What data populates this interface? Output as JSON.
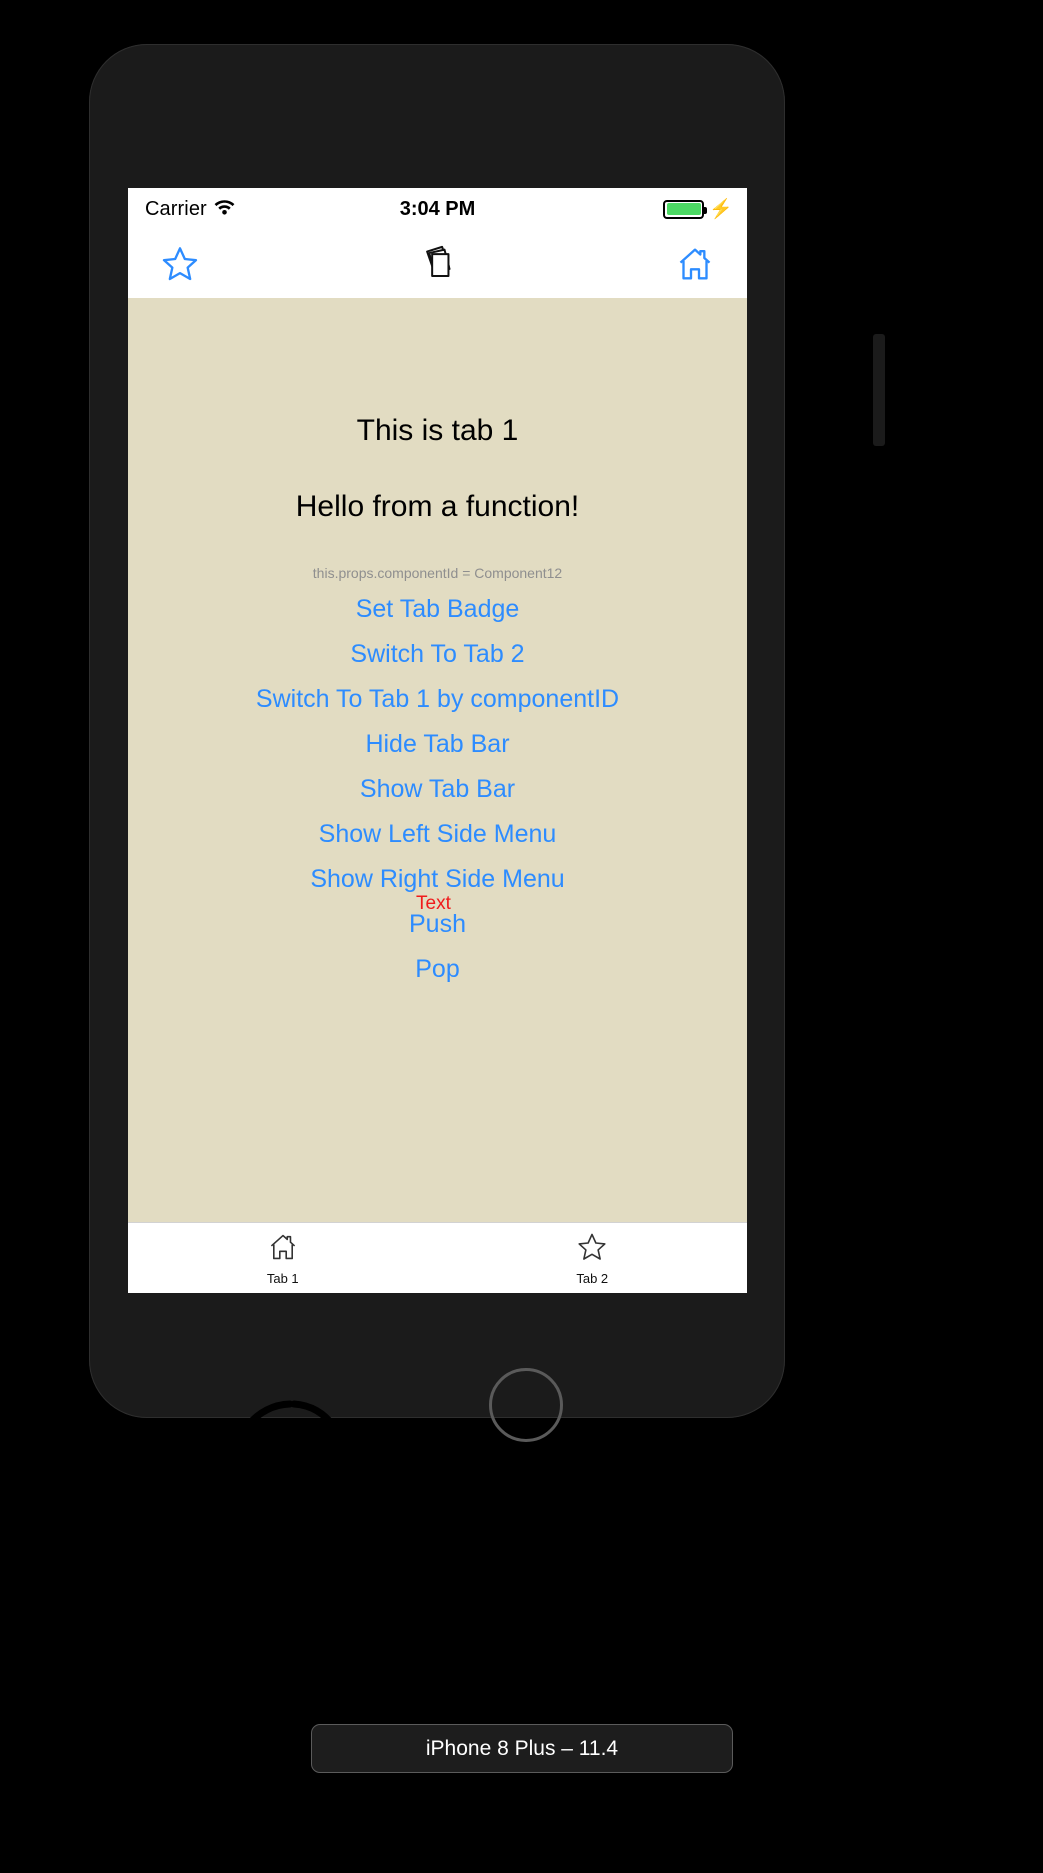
{
  "device": {
    "caption": "iPhone 8 Plus – 11.4"
  },
  "status_bar": {
    "carrier": "Carrier",
    "wifi_icon": "wifi-icon",
    "time": "3:04 PM",
    "battery_icon": "battery-icon",
    "battery_level_percent": 100,
    "battery_color": "#4cd964",
    "charging_icon": "lightning-bolt-icon",
    "charging_glyph": "⚡"
  },
  "nav_bar": {
    "left_icon": "star-outline-icon",
    "center_icon": "stack-of-cards-icon",
    "right_icon": "home-outline-icon",
    "accent_color": "#2d8cff"
  },
  "content": {
    "background_color": "#e2dcc2",
    "heading": "This is tab 1",
    "subheading": "Hello from a function!",
    "component_id_text": "this.props.componentId = Component12",
    "link_color": "#2d8cff",
    "links": [
      {
        "label": "Set Tab Badge"
      },
      {
        "label": "Switch To Tab 2"
      },
      {
        "label": "Switch To Tab 1 by componentID"
      },
      {
        "label": "Hide Tab Bar"
      },
      {
        "label": "Show Tab Bar"
      },
      {
        "label": "Show Left Side Menu"
      },
      {
        "label": "Show Right Side Menu"
      },
      {
        "label": "Push"
      },
      {
        "label": "Pop"
      }
    ]
  },
  "tab_bar": {
    "tabs": [
      {
        "label": "Tab 1",
        "icon": "home-outline-icon",
        "selected": true
      },
      {
        "label": "Tab 2",
        "icon": "star-outline-icon",
        "selected": false
      }
    ]
  },
  "annotations": {
    "circle_target": "tab-1",
    "circle_color": "#000000",
    "text_label": "Text",
    "text_color": "#f01b1b"
  }
}
